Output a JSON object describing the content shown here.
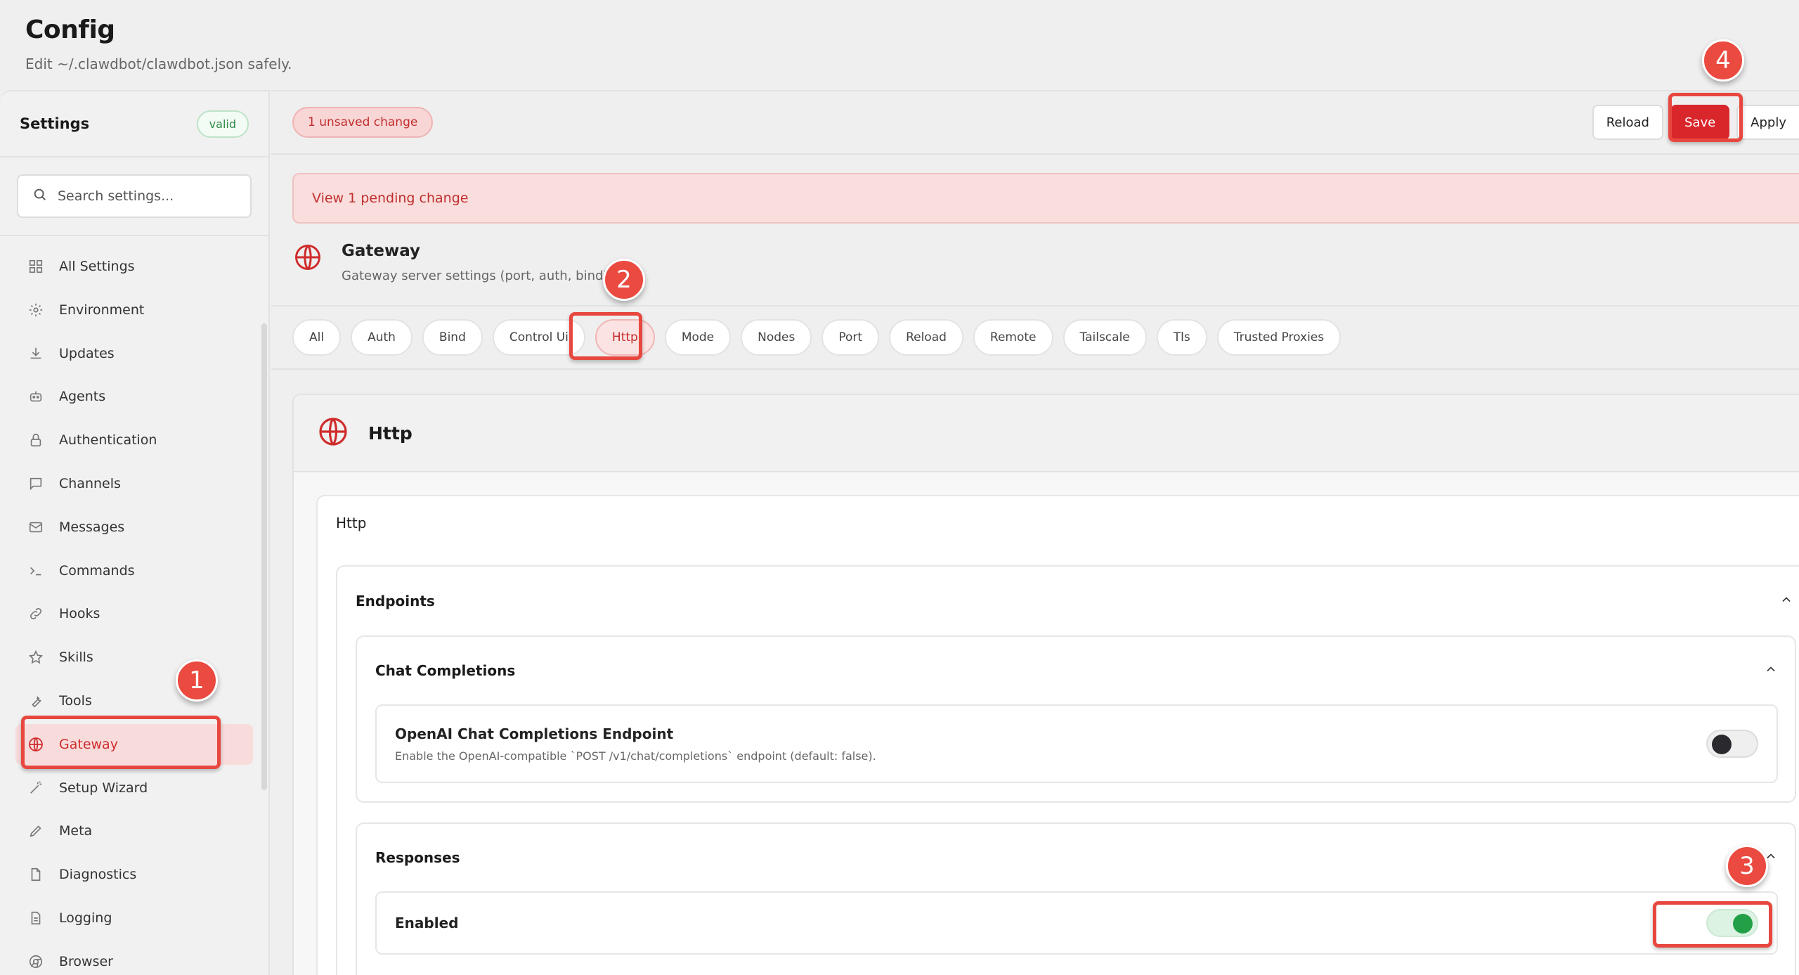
{
  "page": {
    "title": "Config",
    "subtitle": "Edit ~/.clawdbot/clawdbot.json safely."
  },
  "sidebar": {
    "title": "Settings",
    "status_badge": "valid",
    "search_placeholder": "Search settings...",
    "items": [
      {
        "label": "All Settings",
        "icon": "grid-icon"
      },
      {
        "label": "Environment",
        "icon": "gear-icon"
      },
      {
        "label": "Updates",
        "icon": "download-icon"
      },
      {
        "label": "Agents",
        "icon": "robot-icon"
      },
      {
        "label": "Authentication",
        "icon": "lock-icon"
      },
      {
        "label": "Channels",
        "icon": "chat-icon"
      },
      {
        "label": "Messages",
        "icon": "mail-icon"
      },
      {
        "label": "Commands",
        "icon": "terminal-icon"
      },
      {
        "label": "Hooks",
        "icon": "link-icon"
      },
      {
        "label": "Skills",
        "icon": "star-icon"
      },
      {
        "label": "Tools",
        "icon": "wrench-icon"
      },
      {
        "label": "Gateway",
        "icon": "globe-icon",
        "active": true
      },
      {
        "label": "Setup Wizard",
        "icon": "wand-icon"
      },
      {
        "label": "Meta",
        "icon": "pen-icon"
      },
      {
        "label": "Diagnostics",
        "icon": "file-icon"
      },
      {
        "label": "Logging",
        "icon": "document-icon"
      },
      {
        "label": "Browser",
        "icon": "browser-icon"
      }
    ]
  },
  "toolbar": {
    "unsaved_label": "1 unsaved change",
    "reload_label": "Reload",
    "save_label": "Save",
    "apply_label": "Apply"
  },
  "pending_banner": "View 1 pending change",
  "section": {
    "title": "Gateway",
    "description": "Gateway server settings (port, auth, bindin",
    "icon": "globe-icon"
  },
  "tabs": [
    "All",
    "Auth",
    "Bind",
    "Control Ui",
    "Http",
    "Mode",
    "Nodes",
    "Port",
    "Reload",
    "Remote",
    "Tailscale",
    "Tls",
    "Trusted Proxies"
  ],
  "active_tab": "Http",
  "card": {
    "title": "Http",
    "inner_title": "Http",
    "group_title": "Endpoints",
    "chat_completions": {
      "title": "Chat Completions",
      "field_label": "OpenAI Chat Completions Endpoint",
      "field_desc": "Enable the OpenAI-compatible `POST /v1/chat/completions` endpoint (default: false).",
      "enabled": false
    },
    "responses": {
      "title": "Responses",
      "field_label": "Enabled",
      "enabled": true
    }
  },
  "annotations": [
    "1",
    "2",
    "3",
    "4"
  ],
  "colors": {
    "accent": "#d8262b",
    "toggle_on": "#23a047",
    "annotation": "#e8473f"
  }
}
